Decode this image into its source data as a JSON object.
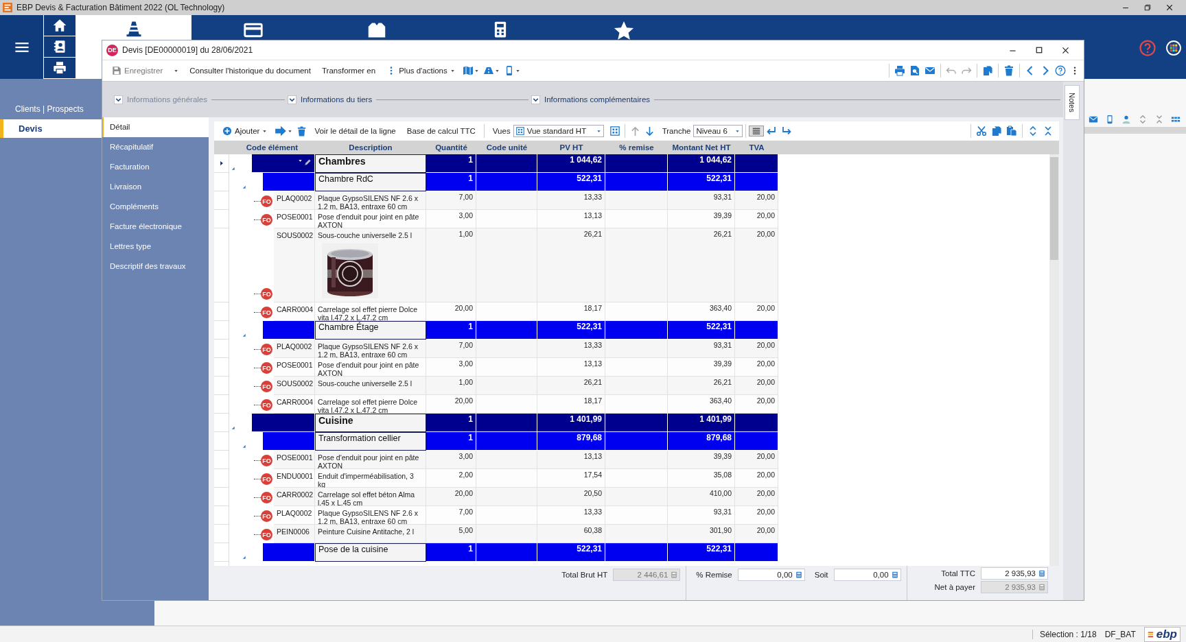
{
  "app": {
    "title": "EBP Devis & Facturation Bâtiment 2022 (OL Technology)"
  },
  "sidebar": {
    "header": "Clients | Prospects",
    "items": [
      {
        "label": "Devis",
        "selected": true
      }
    ]
  },
  "document": {
    "badge": "DE",
    "title": "Devis [DE00000019] du 28/06/2021",
    "toolbar": [
      {
        "kind": "save",
        "label": "Enregistrer",
        "disabled": true
      },
      {
        "kind": "text",
        "label": "Consulter l'historique du document",
        "disabled": false
      },
      {
        "kind": "text",
        "label": "Transformer en",
        "disabled": false
      },
      {
        "kind": "more",
        "label": "Plus d'actions",
        "disabled": false
      }
    ],
    "sections": [
      {
        "label": "Informations générales",
        "disabled": true
      },
      {
        "label": "Informations du tiers",
        "disabled": false
      },
      {
        "label": "Informations complémentaires",
        "disabled": false
      }
    ],
    "notes_tab": "Notes",
    "nav": [
      {
        "label": "Détail",
        "selected": true
      },
      {
        "label": "Récapitulatif",
        "selected": false
      },
      {
        "label": "Facturation",
        "selected": false
      },
      {
        "label": "Livraison",
        "selected": false
      },
      {
        "label": "Compléments",
        "selected": false
      },
      {
        "label": "Facture électronique",
        "selected": false
      },
      {
        "label": "Lettres type",
        "selected": false
      },
      {
        "label": "Descriptif des travaux",
        "selected": false
      }
    ],
    "grid_toolbar": {
      "add": "Ajouter",
      "detail": "Voir le détail de la ligne",
      "ttc": "Base de calcul TTC",
      "views_label": "Vues",
      "view": "Vue standard HT",
      "tranche_label": "Tranche",
      "tranche": "Niveau 6"
    },
    "columns": [
      "Code élément",
      "Description",
      "Quantité",
      "Code unité",
      "PV HT",
      "% remise",
      "Montant Net HT",
      "TVA"
    ],
    "rows": [
      {
        "kind": "group",
        "description": "Chambres",
        "quantity": "1",
        "pv_ht": "1 044,62",
        "net_ht": "1 044,62",
        "expanded": true,
        "current": true,
        "children": [
          {
            "kind": "group",
            "description": "Chambre RdC",
            "quantity": "1",
            "pv_ht": "522,31",
            "net_ht": "522,31",
            "expanded": true,
            "current": false,
            "children": [
              {
                "kind": "item",
                "badge": "FO",
                "code": "PLAQ0002",
                "description": "Plaque GypsoSILENS NF 2.6 x 1.2 m, BA13, entraxe 60 cm",
                "quantity": "7,00",
                "pv_ht": "13,33",
                "net_ht": "93,31",
                "tva": "20,00"
              },
              {
                "kind": "item",
                "badge": "FO",
                "code": "POSE0001",
                "description": "Pose d'enduit pour joint en pâte AXTON",
                "quantity": "3,00",
                "pv_ht": "13,13",
                "net_ht": "39,39",
                "tva": "20,00"
              },
              {
                "kind": "item",
                "badge": "FO",
                "code": "SOUS0002",
                "description": "Sous-couche universelle 2.5 l",
                "quantity": "1,00",
                "pv_ht": "26,21",
                "net_ht": "26,21",
                "tva": "20,00",
                "has_picture": true
              },
              {
                "kind": "item",
                "badge": "FO",
                "code": "CARR0004",
                "description": "Carrelage sol effet pierre Dolce vita l.47.2 x L.47.2 cm",
                "quantity": "20,00",
                "pv_ht": "18,17",
                "net_ht": "363,40",
                "tva": "20,00"
              }
            ]
          },
          {
            "kind": "group",
            "description": "Chambre Étage",
            "quantity": "1",
            "pv_ht": "522,31",
            "net_ht": "522,31",
            "expanded": true,
            "current": false,
            "children": [
              {
                "kind": "item",
                "badge": "FO",
                "code": "PLAQ0002",
                "description": "Plaque GypsoSILENS NF 2.6 x 1.2 m, BA13, entraxe 60 cm",
                "quantity": "7,00",
                "pv_ht": "13,33",
                "net_ht": "93,31",
                "tva": "20,00"
              },
              {
                "kind": "item",
                "badge": "FO",
                "code": "POSE0001",
                "description": "Pose d'enduit pour joint en pâte AXTON",
                "quantity": "3,00",
                "pv_ht": "13,13",
                "net_ht": "39,39",
                "tva": "20,00"
              },
              {
                "kind": "item",
                "badge": "FO",
                "code": "SOUS0002",
                "description": "Sous-couche universelle 2.5 l",
                "quantity": "1,00",
                "pv_ht": "26,21",
                "net_ht": "26,21",
                "tva": "20,00"
              },
              {
                "kind": "item",
                "badge": "FO",
                "code": "CARR0004",
                "description": "Carrelage sol effet pierre Dolce vita l.47.2 x L.47.2 cm",
                "quantity": "20,00",
                "pv_ht": "18,17",
                "net_ht": "363,40",
                "tva": "20,00"
              }
            ]
          }
        ]
      },
      {
        "kind": "group",
        "description": "Cuisine",
        "quantity": "1",
        "pv_ht": "1 401,99",
        "net_ht": "1 401,99",
        "expanded": true,
        "current": false,
        "children": [
          {
            "kind": "group",
            "description": "Transformation cellier",
            "quantity": "1",
            "pv_ht": "879,68",
            "net_ht": "879,68",
            "expanded": true,
            "current": false,
            "children": [
              {
                "kind": "item",
                "badge": "FO",
                "code": "POSE0001",
                "description": "Pose d'enduit pour joint en pâte AXTON",
                "quantity": "3,00",
                "pv_ht": "13,13",
                "net_ht": "39,39",
                "tva": "20,00"
              },
              {
                "kind": "item",
                "badge": "FO",
                "code": "ENDU0001",
                "description": "Enduit d'imperméabilisation, 3 kg",
                "quantity": "2,00",
                "pv_ht": "17,54",
                "net_ht": "35,08",
                "tva": "20,00"
              },
              {
                "kind": "item",
                "badge": "FO",
                "code": "CARR0002",
                "description": "Carrelage sol effet béton Alma l.45 x L.45 cm",
                "quantity": "20,00",
                "pv_ht": "20,50",
                "net_ht": "410,00",
                "tva": "20,00"
              },
              {
                "kind": "item",
                "badge": "FO",
                "code": "PLAQ0002",
                "description": "Plaque GypsoSILENS NF 2.6 x 1.2 m, BA13, entraxe 60 cm",
                "quantity": "7,00",
                "pv_ht": "13,33",
                "net_ht": "93,31",
                "tva": "20,00"
              },
              {
                "kind": "item",
                "badge": "FO",
                "code": "PEIN0006",
                "description": "Peinture Cuisine Antitache, 2 l",
                "quantity": "5,00",
                "pv_ht": "60,38",
                "net_ht": "301,90",
                "tva": "20,00"
              }
            ]
          },
          {
            "kind": "group",
            "description": "Pose de la cuisine",
            "quantity": "1",
            "pv_ht": "522,31",
            "net_ht": "522,31",
            "expanded": true,
            "current": false
          }
        ]
      }
    ],
    "totals": [
      {
        "kind": "row",
        "fields": [
          {
            "label": "Total Brut HT",
            "value": "2 446,61",
            "disabled": true
          }
        ]
      },
      {
        "kind": "row",
        "fields": [
          {
            "label": "% Remise",
            "value": "0,00",
            "disabled": false
          },
          {
            "label": "Soit",
            "value": "0,00",
            "disabled": false
          }
        ]
      },
      {
        "kind": "stack",
        "fields": [
          {
            "label": "Total TTC",
            "value": "2 935,93",
            "disabled": false
          },
          {
            "label": "Net à payer",
            "value": "2 935,93",
            "disabled": true
          }
        ]
      }
    ]
  },
  "status_bar": {
    "selection": "Sélection : 1/18",
    "database": "DF_BAT",
    "logo": "ebp"
  }
}
